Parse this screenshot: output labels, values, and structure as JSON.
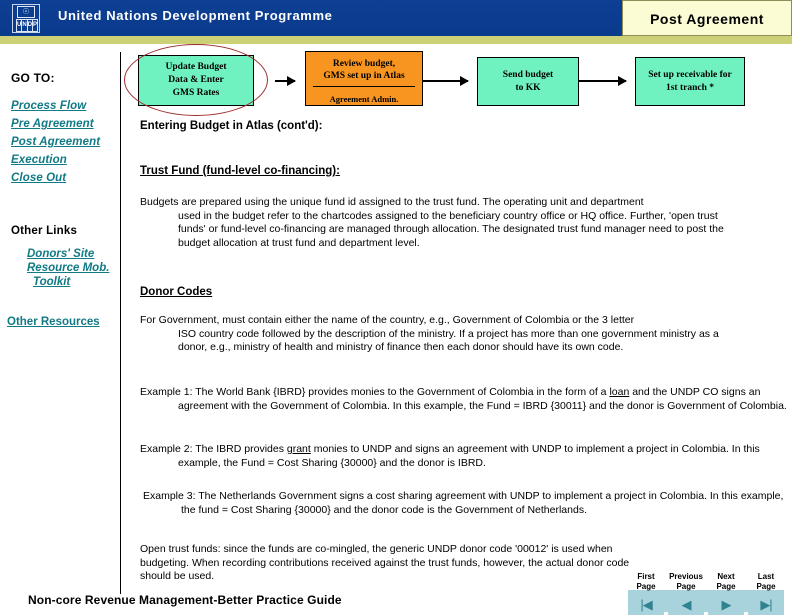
{
  "header": {
    "title": "United Nations Development Programme",
    "logo_emblem": "un-emblem",
    "logo_letters": [
      "U",
      "N",
      "D",
      "P"
    ],
    "section_tab": "Post Agreement",
    "colors": {
      "band": "#0b3d91",
      "olive": "#ccd177",
      "tab_bg": "#fbfbd4"
    }
  },
  "sidebar": {
    "goto_label": "GO TO:",
    "items": [
      {
        "label": "Process Flow"
      },
      {
        "label": "Pre Agreement"
      },
      {
        "label": "Post Agreement"
      },
      {
        "label": "Execution"
      },
      {
        "label": "Close Out"
      }
    ],
    "other_links_heading": "Other Links",
    "other_links": [
      {
        "label": "Donors' Site"
      },
      {
        "label": "Resource Mob."
      },
      {
        "label": "Toolkit"
      }
    ],
    "other_resources": "Other Resources",
    "link_color": "#117a84"
  },
  "flow": {
    "boxes": [
      {
        "id": "update-budget",
        "color": "#6ff2c0",
        "lines": [
          "Update Budget",
          "Data & Enter",
          "GMS Rates"
        ],
        "highlighted": true
      },
      {
        "id": "review-budget",
        "color": "#f79520",
        "lines": [
          "Review budget,",
          "GMS set up in Atlas"
        ],
        "role": "Agreement Admin."
      },
      {
        "id": "send-budget",
        "color": "#6ff2c0",
        "lines": [
          "Send budget",
          "to KK"
        ]
      },
      {
        "id": "setup-receivable",
        "color": "#6ff2c0",
        "lines": [
          "Set up receivable for",
          "1st tranch *"
        ]
      }
    ],
    "highlight_color": "#9e2c2c"
  },
  "content": {
    "title": "Entering Budget in Atlas (cont'd):",
    "trust_fund_heading": "Trust Fund (fund-level co-financing):",
    "trust_fund_paragraph_line1": "Budgets are prepared  using the unique fund id assigned to the trust fund.  The operating unit and department",
    "trust_fund_paragraph_rest": "used in the budget refer to the chartcodes assigned to the beneficiary country office or HQ office. Further, 'open trust funds' or fund-level co-financing are managed through allocation.  The designated trust fund manager need to post the budget allocation at trust fund and department level.",
    "donor_codes_heading": "Donor Codes",
    "donor_codes_line1": "For Government, must contain either the name of the country, e.g., Government of Colombia or the 3 letter",
    "donor_codes_rest": "ISO country code followed by the description of the ministry.   If a project has more than one government ministry as a donor, e.g., ministry of health and ministry of finance then each donor should have its own code.",
    "example_1_pre": "Example 1:  The World Bank {IBRD} provides monies to the Government of Colombia in the form of a ",
    "example_1_underlined": "loan",
    "example_1_post": " and the UNDP CO signs an agreement with the Government of Colombia.  In this example, the Fund = IBRD {30011} and the donor is Government of Colombia.",
    "example_2_pre": "Example 2:  The IBRD provides ",
    "example_2_underlined": "grant",
    "example_2_post": " monies to UNDP and signs an agreement with UNDP to implement a project in Colombia.  In this example, the Fund = Cost Sharing {30000} and the donor is IBRD.",
    "example_3": "Example 3:  The Netherlands Government signs a cost sharing agreement with UNDP to implement a project in Colombia.  In this example, the fund = Cost Sharing {30000} and the donor code is the Government of Netherlands.",
    "open_trust_funds": "Open trust funds:  since the funds are co-mingled, the generic UNDP donor code '00012' is used when budgeting.  When recording contributions received against the trust funds, however, the actual donor code  should be used."
  },
  "footer": {
    "title": "Non-core Revenue Management-Better Practice Guide",
    "nav_buttons": [
      {
        "label_line1": "First",
        "label_line2": "Page",
        "glyph": "|◀",
        "icon": "first-page-icon"
      },
      {
        "label_line1": "Previous",
        "label_line2": "Page",
        "glyph": "◀",
        "icon": "previous-page-icon"
      },
      {
        "label_line1": "Next",
        "label_line2": "Page",
        "glyph": "▶",
        "icon": "next-page-icon"
      },
      {
        "label_line1": "Last",
        "label_line2": "Page",
        "glyph": "▶|",
        "icon": "last-page-icon"
      }
    ],
    "nav_bg_color": "#a8d3dd"
  }
}
